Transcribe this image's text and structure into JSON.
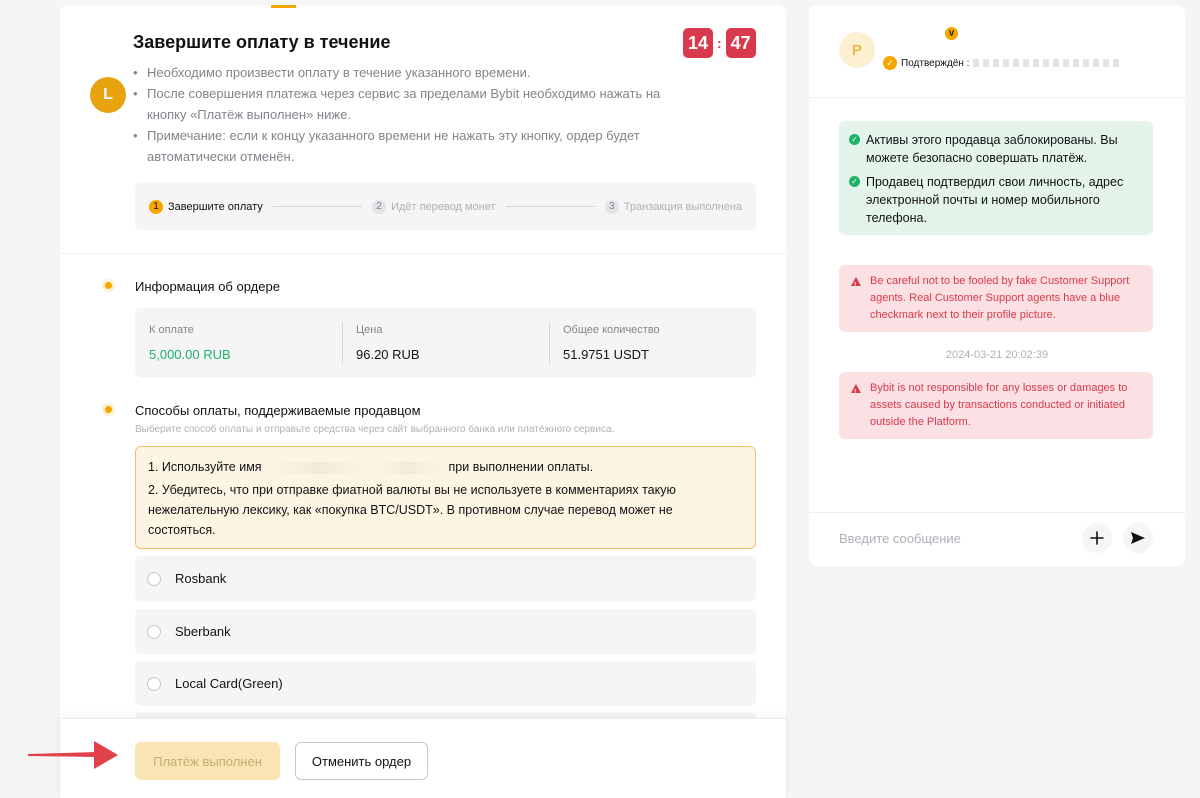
{
  "order": {
    "avatar_letter": "L",
    "title": "Завершите оплату в течение",
    "timer": {
      "minutes": "14",
      "separator": ":",
      "seconds": "47"
    },
    "instructions": [
      "Необходимо произвести оплату в течение указанного времени.",
      "После совершения платежа через сервис за пределами Bybit необходимо нажать на кнопку «Платёж выполнен» ниже.",
      "Примечание: если к концу указанного времени не нажать эту кнопку, ордер будет автоматически отменён."
    ],
    "steps": [
      {
        "num": "1",
        "label": "Завершите оплату",
        "active": true
      },
      {
        "num": "2",
        "label": "Идёт перевод монет",
        "active": false
      },
      {
        "num": "3",
        "label": "Транзакция выполнена",
        "active": false
      }
    ],
    "info_title": "Информация об ордере",
    "info": [
      {
        "label": "К оплате",
        "value": "5,000.00 RUB"
      },
      {
        "label": "Цена",
        "value": "96.20 RUB"
      },
      {
        "label": "Общее количество",
        "value": "51.9751 USDT"
      }
    ],
    "methods_title": "Способы оплаты, поддерживаемые продавцом",
    "methods_subtitle": "Выберите способ оплаты и отправьте средства через сайт выбранного банка или платёжного сервиса.",
    "notice": {
      "line1_prefix": "1. Используйте имя",
      "line1_suffix": "при выполнении оплаты.",
      "line2": "2. Убедитесь, что при отправке фиатной валюты вы не используете в комментариях такую нежелательную лексику, как «покупка BTC/USDT». В противном случае перевод может не состояться."
    },
    "payment_methods": [
      "Rosbank",
      "Sberbank",
      "Local Card(Green)"
    ],
    "buttons": {
      "paid": "Платёж выполнен",
      "cancel": "Отменить ордер"
    }
  },
  "chat": {
    "seller_avatar_letter": "P",
    "seller_badge": "V",
    "verified_label": "Подтверждён :",
    "green_notes": [
      "Активы этого продавца заблокированы. Вы можете безопасно совершать платёж.",
      "Продавец подтвердил свои личность, адрес электронной почты и номер мобильного телефона."
    ],
    "warning_1": "Be careful not to be fooled by fake Customer Support agents. Real Customer Support agents have a blue checkmark next to their profile picture.",
    "timestamp": "2024-03-21 20:02:39",
    "warning_2": "Bybit is not responsible for any losses or damages to assets caused by transactions conducted or initiated outside the Platform.",
    "input_placeholder": "Введите сообщение"
  },
  "colors": {
    "accent": "#f7a600",
    "timer_red": "#d9394c",
    "amount_green": "#20b26c",
    "arrow_red": "#e0414a"
  }
}
